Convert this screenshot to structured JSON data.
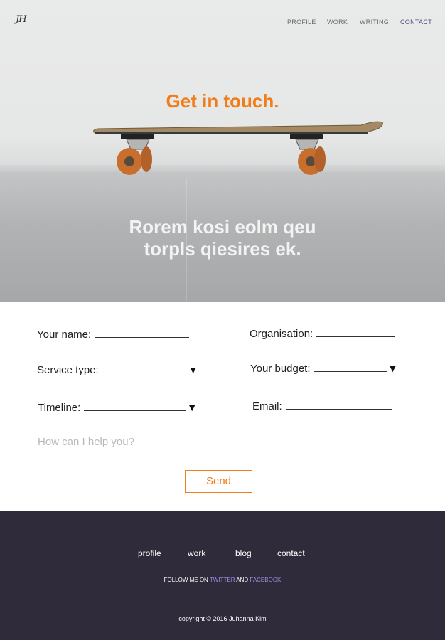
{
  "brand": {
    "logo_text": "JH"
  },
  "nav": {
    "items": [
      {
        "label": "PROFILE",
        "active": false
      },
      {
        "label": "WORK",
        "active": false
      },
      {
        "label": "WRITING",
        "active": false
      },
      {
        "label": "CONTACT",
        "active": true
      }
    ]
  },
  "hero": {
    "headline": "Get in touch.",
    "tagline_line1": "Rorem kosi eolm qeu",
    "tagline_line2": "torpls qiesires ek."
  },
  "form": {
    "name_label": "Your name:",
    "organisation_label": "Organisation:",
    "service_label": "Service type:",
    "budget_label": "Your budget:",
    "timeline_label": "Timeline:",
    "email_label": "Email:",
    "help_placeholder": "How can I help you?",
    "send_label": "Send",
    "dropdown_glyph": "▼"
  },
  "footer": {
    "links": [
      "profile",
      "work",
      "blog",
      "contact"
    ],
    "follow_prefix": "FOLLOW ME ON",
    "twitter": "TWITTER",
    "and": "AND",
    "facebook": "FACEBOOK",
    "copyright": "copyright © 2016 Juhanna Kim"
  },
  "colors": {
    "accent": "#f07d1a",
    "footer_bg": "#2f2b3a",
    "link_accent": "#9b8fe0",
    "nav_active": "#55507a"
  }
}
